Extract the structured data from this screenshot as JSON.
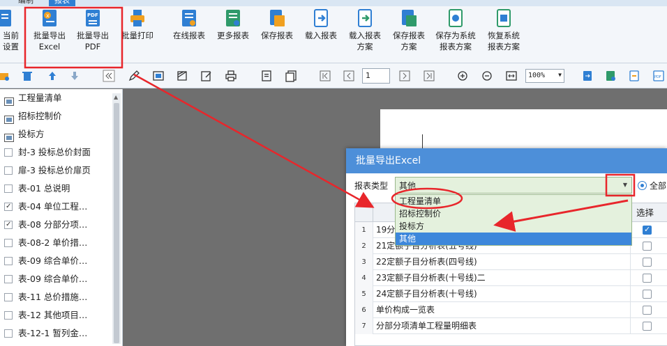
{
  "tabs": [
    {
      "label": "编制",
      "active": false
    },
    {
      "label": "报表",
      "active": true
    }
  ],
  "ribbon": {
    "current_settings": {
      "l1": "当前",
      "l2": "设置"
    },
    "batch_excel": {
      "l1": "批量导出",
      "l2": "Excel"
    },
    "batch_pdf": {
      "l1": "批量导出",
      "l2": "PDF"
    },
    "batch_print": {
      "l1": "批量打印",
      "l2": ""
    },
    "online_report": {
      "l1": "在线报表",
      "l2": ""
    },
    "more_reports": {
      "l1": "更多报表",
      "l2": ""
    },
    "save_report": {
      "l1": "保存报表",
      "l2": ""
    },
    "load_report": {
      "l1": "载入报表",
      "l2": ""
    },
    "load_scheme": {
      "l1": "载入报表",
      "l2": "方案"
    },
    "save_scheme": {
      "l1": "保存报表",
      "l2": "方案"
    },
    "save_as_system": {
      "l1": "保存为系统",
      "l2": "报表方案"
    },
    "restore_system": {
      "l1": "恢复系统",
      "l2": "报表方案"
    }
  },
  "toolbar": {
    "page_number": "1",
    "zoom": "100%"
  },
  "tree": {
    "items": [
      {
        "label": "工程量清单",
        "kind": "folder"
      },
      {
        "label": "招标控制价",
        "kind": "folder"
      },
      {
        "label": "投标方",
        "kind": "folder"
      },
      {
        "label": "封-3 投标总价封面",
        "kind": "check",
        "checked": false
      },
      {
        "label": "扉-3 投标总价扉页",
        "kind": "check",
        "checked": false
      },
      {
        "label": "表-01 总说明",
        "kind": "check",
        "checked": false
      },
      {
        "label": "表-04 单位工程…",
        "kind": "check",
        "checked": true
      },
      {
        "label": "表-08 分部分项…",
        "kind": "check",
        "checked": true
      },
      {
        "label": "表-08-2 单价措…",
        "kind": "check",
        "checked": false
      },
      {
        "label": "表-09 综合单价…",
        "kind": "check",
        "checked": false
      },
      {
        "label": "表-09 综合单价…",
        "kind": "check",
        "checked": false
      },
      {
        "label": "表-11 总价措施…",
        "kind": "check",
        "checked": false
      },
      {
        "label": "表-12 其他项目…",
        "kind": "check",
        "checked": false
      },
      {
        "label": "表-12-1 暂列金…",
        "kind": "check",
        "checked": false
      }
    ]
  },
  "dialog": {
    "title": "批量导出Excel",
    "type_label": "报表类型",
    "type_value": "其他",
    "radio_label": "全部",
    "select_header": "选择",
    "dropdown_options": [
      {
        "label": "工程量清单",
        "selected": false
      },
      {
        "label": "招标控制价",
        "selected": false
      },
      {
        "label": "投标方",
        "selected": false
      },
      {
        "label": "其他",
        "selected": true
      }
    ],
    "rows": [
      {
        "num": "1",
        "name": "19分",
        "checked": true
      },
      {
        "num": "2",
        "name": "21定额子目分析表(五号线)",
        "checked": false
      },
      {
        "num": "3",
        "name": "22定额子目分析表(四号线)",
        "checked": false
      },
      {
        "num": "4",
        "name": "23定额子目分析表(十号线)二",
        "checked": false
      },
      {
        "num": "5",
        "name": "24定额子目分析表(十号线)",
        "checked": false
      },
      {
        "num": "6",
        "name": "单价构成一览表",
        "checked": false
      },
      {
        "num": "7",
        "name": "分部分项清单工程量明细表",
        "checked": false
      }
    ]
  },
  "colors": {
    "accent": "#2f7fd3",
    "dialog_title": "#4d8fd9",
    "annotation_red": "#e8262b",
    "dropdown_bg": "#e4f1dd"
  }
}
